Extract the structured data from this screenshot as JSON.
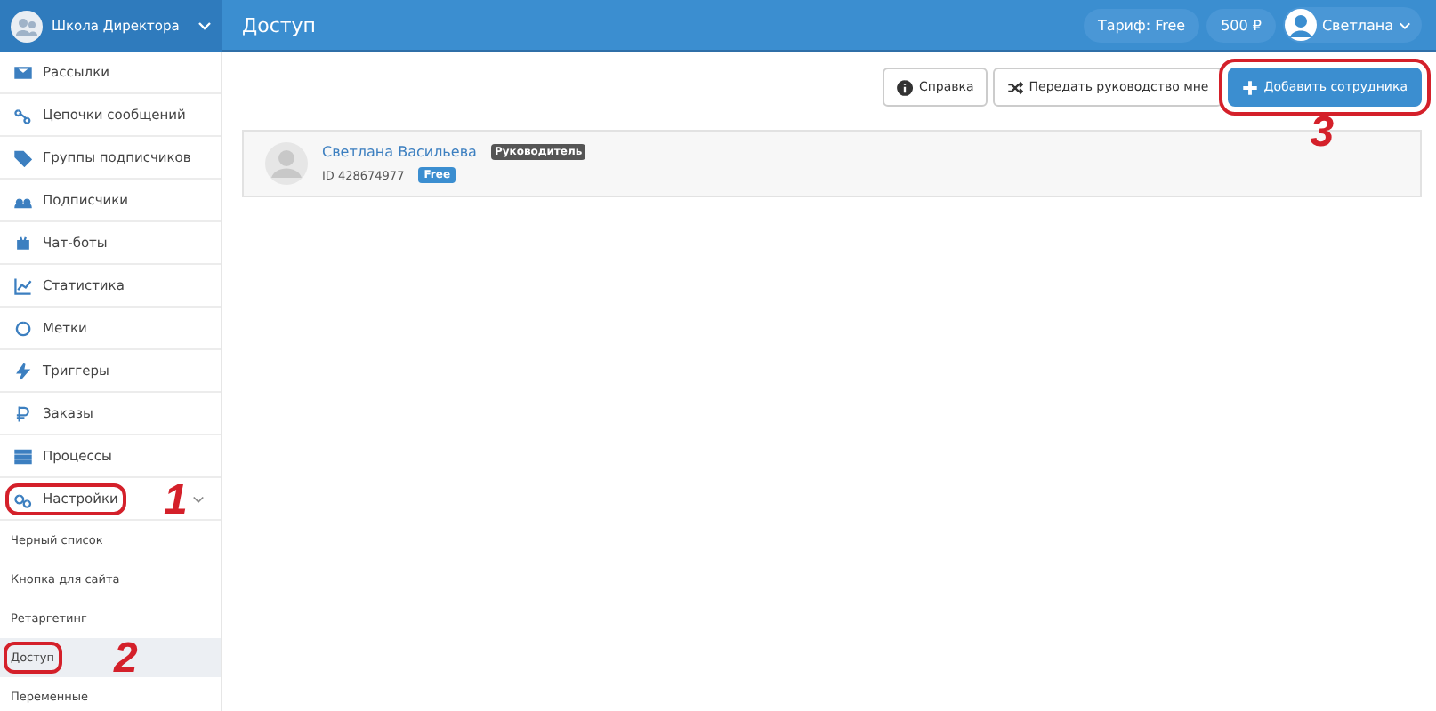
{
  "account": {
    "name": "Школа Директора"
  },
  "page_title": "Доступ",
  "header": {
    "tariff": "Тариф: Free",
    "balance": "500 ₽",
    "user": "Светлана"
  },
  "sidebar": {
    "items": [
      {
        "kind": "main",
        "label": "Рассылки",
        "selected": false
      },
      {
        "kind": "main",
        "label": "Цепочки сообщений",
        "selected": false
      },
      {
        "kind": "main",
        "label": "Группы подписчиков",
        "selected": false
      },
      {
        "kind": "main",
        "label": "Подписчики",
        "selected": false
      },
      {
        "kind": "main",
        "label": "Чат-боты",
        "selected": false
      },
      {
        "kind": "main",
        "label": "Статистика",
        "selected": false
      },
      {
        "kind": "main",
        "label": "Метки",
        "selected": false
      },
      {
        "kind": "main",
        "label": "Триггеры",
        "selected": false
      },
      {
        "kind": "main",
        "label": "Заказы",
        "selected": false
      },
      {
        "kind": "main",
        "label": "Процессы",
        "selected": false
      },
      {
        "kind": "group",
        "label": "Настройки",
        "expanded": true,
        "selected": false,
        "annotation": "1"
      },
      {
        "kind": "sub",
        "label": "Черный список",
        "selected": false
      },
      {
        "kind": "sub",
        "label": "Кнопка для сайта",
        "selected": false
      },
      {
        "kind": "sub",
        "label": "Ретаргетинг",
        "selected": false
      },
      {
        "kind": "sub",
        "label": "Доступ",
        "selected": true,
        "annotation": "2"
      },
      {
        "kind": "sub",
        "label": "Переменные",
        "selected": false
      }
    ]
  },
  "toolbar": [
    {
      "kind": "default",
      "label": "Справка"
    },
    {
      "kind": "default",
      "label": "Передать руководство мне"
    },
    {
      "kind": "primary",
      "label": "Добавить сотрудника",
      "annotation": "3"
    }
  ],
  "members": [
    {
      "name": "Светлана Васильева",
      "role": "Руководитель",
      "id": "ID 428674977",
      "plan": "Free"
    }
  ]
}
